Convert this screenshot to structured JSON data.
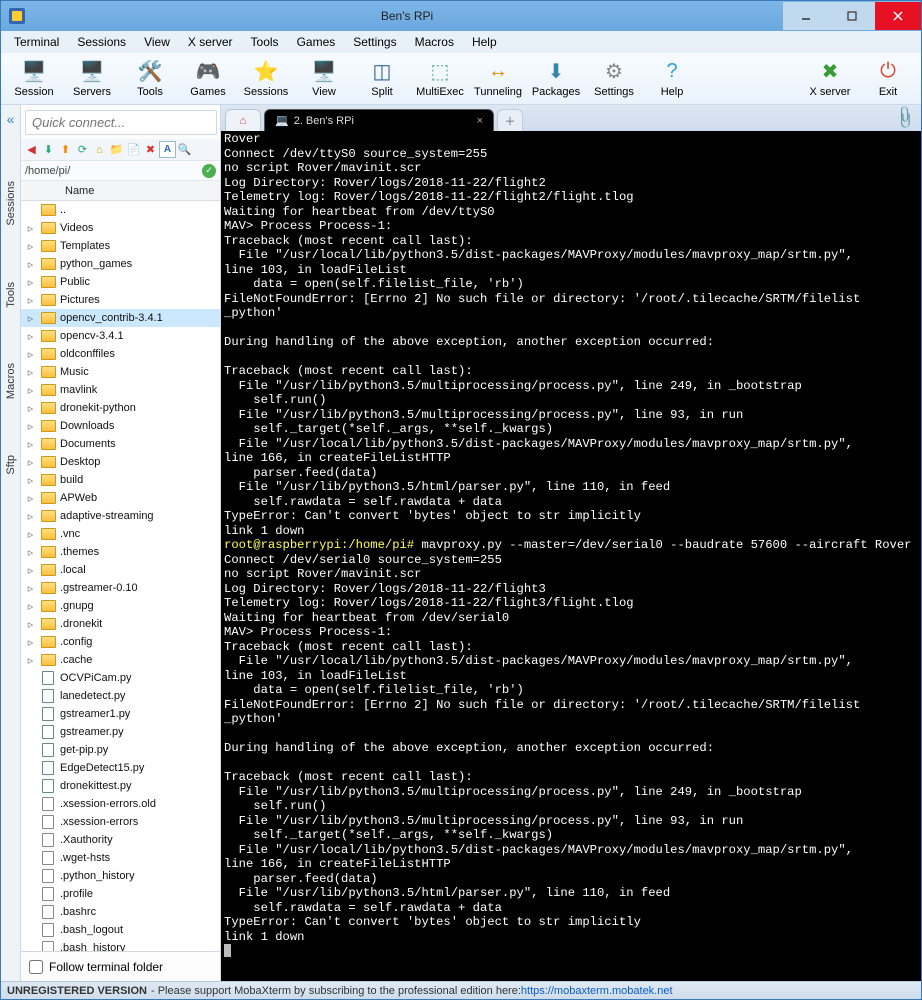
{
  "window": {
    "title": "Ben's RPi"
  },
  "menubar": [
    "Terminal",
    "Sessions",
    "View",
    "X server",
    "Tools",
    "Games",
    "Settings",
    "Macros",
    "Help"
  ],
  "toolbar": [
    {
      "label": "Session",
      "glyph": "🖥️",
      "color": "#3478c8"
    },
    {
      "label": "Servers",
      "glyph": "🖥️",
      "color": "#666"
    },
    {
      "label": "Tools",
      "glyph": "🛠️",
      "color": "#d06"
    },
    {
      "label": "Games",
      "glyph": "🎮",
      "color": "#777"
    },
    {
      "label": "Sessions",
      "glyph": "⭐",
      "color": "#f0b000"
    },
    {
      "label": "View",
      "glyph": "🖥️",
      "color": "#58a"
    },
    {
      "label": "Split",
      "glyph": "◫",
      "color": "#369"
    },
    {
      "label": "MultiExec",
      "glyph": "⬚",
      "color": "#5a8"
    },
    {
      "label": "Tunneling",
      "glyph": "↔",
      "color": "#e80"
    },
    {
      "label": "Packages",
      "glyph": "⬇",
      "color": "#38a"
    },
    {
      "label": "Settings",
      "glyph": "⚙",
      "color": "#888"
    },
    {
      "label": "Help",
      "glyph": "?",
      "color": "#2aa0e0"
    }
  ],
  "toolbar_right": [
    {
      "label": "X server",
      "glyph": "✖",
      "color": "#3a9a33"
    },
    {
      "label": "Exit",
      "glyph": "⏻",
      "color": "#e04428"
    }
  ],
  "quick_placeholder": "Quick connect...",
  "sidebar_vtabs": [
    "Sessions",
    "Tools",
    "Macros",
    "Sftp"
  ],
  "sftp_path": "/home/pi/",
  "list_header": "Name",
  "files": [
    {
      "n": "..",
      "t": "up"
    },
    {
      "n": "Videos",
      "t": "dir"
    },
    {
      "n": "Templates",
      "t": "dir"
    },
    {
      "n": "python_games",
      "t": "dir"
    },
    {
      "n": "Public",
      "t": "dir"
    },
    {
      "n": "Pictures",
      "t": "dir"
    },
    {
      "n": "opencv_contrib-3.4.1",
      "t": "dir",
      "selected": true
    },
    {
      "n": "opencv-3.4.1",
      "t": "dir"
    },
    {
      "n": "oldconffiles",
      "t": "dir"
    },
    {
      "n": "Music",
      "t": "dir"
    },
    {
      "n": "mavlink",
      "t": "dir"
    },
    {
      "n": "dronekit-python",
      "t": "dir"
    },
    {
      "n": "Downloads",
      "t": "dir"
    },
    {
      "n": "Documents",
      "t": "dir"
    },
    {
      "n": "Desktop",
      "t": "dir"
    },
    {
      "n": "build",
      "t": "dir"
    },
    {
      "n": "APWeb",
      "t": "dir"
    },
    {
      "n": "adaptive-streaming",
      "t": "dir"
    },
    {
      "n": ".vnc",
      "t": "dir"
    },
    {
      "n": ".themes",
      "t": "dir"
    },
    {
      "n": ".local",
      "t": "dir"
    },
    {
      "n": ".gstreamer-0.10",
      "t": "dir"
    },
    {
      "n": ".gnupg",
      "t": "dir"
    },
    {
      "n": ".dronekit",
      "t": "dir"
    },
    {
      "n": ".config",
      "t": "dir"
    },
    {
      "n": ".cache",
      "t": "dir"
    },
    {
      "n": "OCVPiCam.py",
      "t": "py"
    },
    {
      "n": "lanedetect.py",
      "t": "py"
    },
    {
      "n": "gstreamer1.py",
      "t": "py"
    },
    {
      "n": "gstreamer.py",
      "t": "py"
    },
    {
      "n": "get-pip.py",
      "t": "py"
    },
    {
      "n": "EdgeDetect15.py",
      "t": "py"
    },
    {
      "n": "dronekittest.py",
      "t": "py"
    },
    {
      "n": ".xsession-errors.old",
      "t": "file"
    },
    {
      "n": ".xsession-errors",
      "t": "file"
    },
    {
      "n": ".Xauthority",
      "t": "file"
    },
    {
      "n": ".wget-hsts",
      "t": "file"
    },
    {
      "n": ".python_history",
      "t": "file"
    },
    {
      "n": ".profile",
      "t": "file"
    },
    {
      "n": ".bashrc",
      "t": "file"
    },
    {
      "n": ".bash_logout",
      "t": "file"
    },
    {
      "n": ".bash_history",
      "t": "file"
    }
  ],
  "follow_label": "Follow terminal folder",
  "tabs": {
    "active_label": "2. Ben's RPi"
  },
  "terminal_lines": [
    "Rover",
    "Connect /dev/ttyS0 source_system=255",
    "no script Rover/mavinit.scr",
    "Log Directory: Rover/logs/2018-11-22/flight2",
    "Telemetry log: Rover/logs/2018-11-22/flight2/flight.tlog",
    "Waiting for heartbeat from /dev/ttyS0",
    "MAV> Process Process-1:",
    "Traceback (most recent call last):",
    "  File \"/usr/local/lib/python3.5/dist-packages/MAVProxy/modules/mavproxy_map/srtm.py\",",
    "line 103, in loadFileList",
    "    data = open(self.filelist_file, 'rb')",
    "FileNotFoundError: [Errno 2] No such file or directory: '/root/.tilecache/SRTM/filelist",
    "_python'",
    "",
    "During handling of the above exception, another exception occurred:",
    "",
    "Traceback (most recent call last):",
    "  File \"/usr/lib/python3.5/multiprocessing/process.py\", line 249, in _bootstrap",
    "    self.run()",
    "  File \"/usr/lib/python3.5/multiprocessing/process.py\", line 93, in run",
    "    self._target(*self._args, **self._kwargs)",
    "  File \"/usr/local/lib/python3.5/dist-packages/MAVProxy/modules/mavproxy_map/srtm.py\",",
    "line 166, in createFileListHTTP",
    "    parser.feed(data)",
    "  File \"/usr/lib/python3.5/html/parser.py\", line 110, in feed",
    "    self.rawdata = self.rawdata + data",
    "TypeError: Can't convert 'bytes' object to str implicitly",
    "link 1 down"
  ],
  "terminal_prompt_line": "root@raspberrypi:/home/pi# mavproxy.py --master=/dev/serial0 --baudrate 57600 --aircraft Rover",
  "terminal_lines2": [
    "Connect /dev/serial0 source_system=255",
    "no script Rover/mavinit.scr",
    "Log Directory: Rover/logs/2018-11-22/flight3",
    "Telemetry log: Rover/logs/2018-11-22/flight3/flight.tlog",
    "Waiting for heartbeat from /dev/serial0",
    "MAV> Process Process-1:",
    "Traceback (most recent call last):",
    "  File \"/usr/local/lib/python3.5/dist-packages/MAVProxy/modules/mavproxy_map/srtm.py\",",
    "line 103, in loadFileList",
    "    data = open(self.filelist_file, 'rb')",
    "FileNotFoundError: [Errno 2] No such file or directory: '/root/.tilecache/SRTM/filelist",
    "_python'",
    "",
    "During handling of the above exception, another exception occurred:",
    "",
    "Traceback (most recent call last):",
    "  File \"/usr/lib/python3.5/multiprocessing/process.py\", line 249, in _bootstrap",
    "    self.run()",
    "  File \"/usr/lib/python3.5/multiprocessing/process.py\", line 93, in run",
    "    self._target(*self._args, **self._kwargs)",
    "  File \"/usr/local/lib/python3.5/dist-packages/MAVProxy/modules/mavproxy_map/srtm.py\",",
    "line 166, in createFileListHTTP",
    "    parser.feed(data)",
    "  File \"/usr/lib/python3.5/html/parser.py\", line 110, in feed",
    "    self.rawdata = self.rawdata + data",
    "TypeError: Can't convert 'bytes' object to str implicitly",
    "link 1 down"
  ],
  "status": {
    "prefix": "UNREGISTERED VERSION",
    "msg": " - Please support MobaXterm by subscribing to the professional edition here: ",
    "link": "https://mobaxterm.mobatek.net"
  }
}
